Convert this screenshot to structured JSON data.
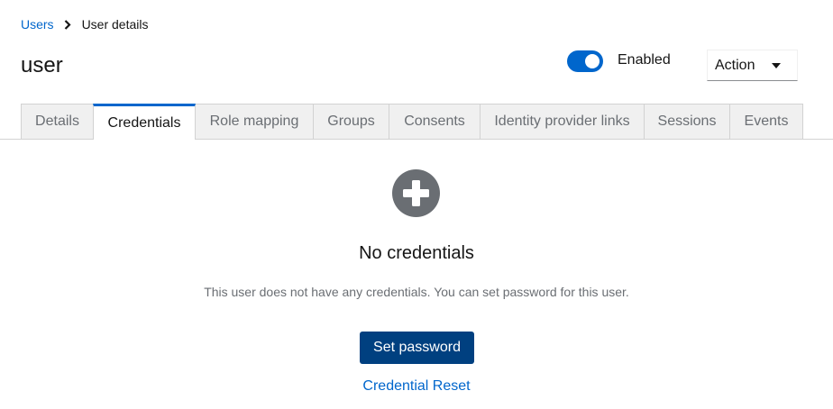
{
  "breadcrumb": {
    "parent": "Users",
    "current": "User details"
  },
  "header": {
    "title": "user",
    "enabled_label": "Enabled",
    "enabled": true,
    "action_label": "Action"
  },
  "tabs": [
    {
      "label": "Details",
      "active": false
    },
    {
      "label": "Credentials",
      "active": true
    },
    {
      "label": "Role mapping",
      "active": false
    },
    {
      "label": "Groups",
      "active": false
    },
    {
      "label": "Consents",
      "active": false
    },
    {
      "label": "Identity provider links",
      "active": false
    },
    {
      "label": "Sessions",
      "active": false
    },
    {
      "label": "Events",
      "active": false
    }
  ],
  "empty_state": {
    "icon": "plus-circle-icon",
    "title": "No credentials",
    "body": "This user does not have any credentials. You can set password for this user.",
    "primary_action": "Set password",
    "secondary_action": "Credential Reset"
  },
  "colors": {
    "accent": "#0066cc",
    "primary_button": "#004080",
    "icon_gray": "#6a6e73"
  }
}
